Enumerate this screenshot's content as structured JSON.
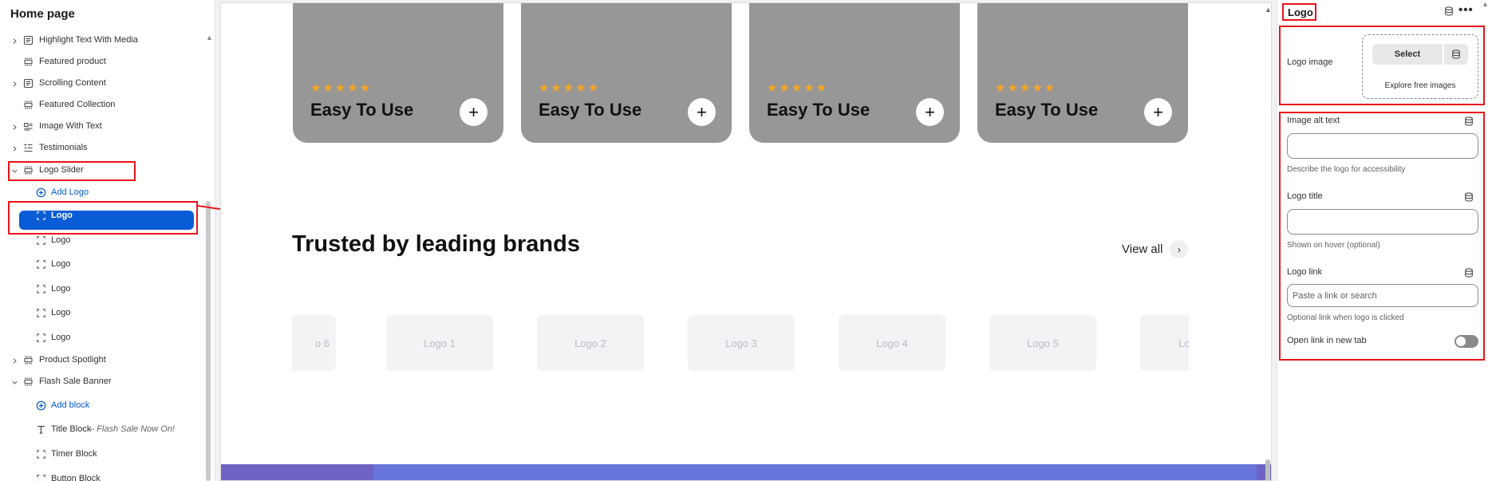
{
  "sidebar": {
    "title": "Home page",
    "items": [
      {
        "label": "Highlight Text With Media",
        "sub": "",
        "type": "section",
        "icon": "text-section-icon",
        "expand": ">",
        "selected": false
      },
      {
        "label": "Featured product",
        "sub": "",
        "type": "section",
        "icon": "layout-section-icon",
        "expand": "",
        "selected": false
      },
      {
        "label": "Scrolling Content",
        "sub": "",
        "type": "section",
        "icon": "text-section-icon",
        "expand": ">",
        "selected": false
      },
      {
        "label": "Featured Collection",
        "sub": "",
        "type": "section",
        "icon": "layout-section-icon",
        "expand": "",
        "selected": false
      },
      {
        "label": "Image With Text",
        "sub": "",
        "type": "section",
        "icon": "image-text-section-icon",
        "expand": ">",
        "selected": false
      },
      {
        "label": "Testimonials",
        "sub": "",
        "type": "section",
        "icon": "list-section-icon",
        "expand": ">",
        "selected": false
      },
      {
        "label": "Logo Slider",
        "sub": "",
        "type": "section",
        "icon": "layout-section-icon",
        "expand": "v",
        "selected": false
      },
      {
        "label": "Add Logo",
        "sub": "",
        "type": "add",
        "icon": "plus-circle-icon",
        "expand": "",
        "selected": false
      },
      {
        "label": "Logo",
        "sub": "",
        "type": "block",
        "icon": "block-icon",
        "expand": "",
        "selected": true
      },
      {
        "label": "Logo",
        "sub": "",
        "type": "block",
        "icon": "block-icon",
        "expand": "",
        "selected": false
      },
      {
        "label": "Logo",
        "sub": "",
        "type": "block",
        "icon": "block-icon",
        "expand": "",
        "selected": false
      },
      {
        "label": "Logo",
        "sub": "",
        "type": "block",
        "icon": "block-icon",
        "expand": "",
        "selected": false
      },
      {
        "label": "Logo",
        "sub": "",
        "type": "block",
        "icon": "block-icon",
        "expand": "",
        "selected": false
      },
      {
        "label": "Logo",
        "sub": "",
        "type": "block",
        "icon": "block-icon",
        "expand": "",
        "selected": false
      },
      {
        "label": "Product Spotlight",
        "sub": "",
        "type": "section",
        "icon": "layout-section-icon",
        "expand": ">",
        "selected": false
      },
      {
        "label": "Flash Sale Banner",
        "sub": "",
        "type": "section",
        "icon": "layout-section-icon",
        "expand": "v",
        "selected": false
      },
      {
        "label": "Add block",
        "sub": "",
        "type": "add",
        "icon": "plus-circle-icon",
        "expand": "",
        "selected": false
      },
      {
        "label": "Title Block",
        "sub": "– Flash Sale Now On!",
        "type": "block",
        "icon": "text-t-icon",
        "expand": "",
        "selected": false
      },
      {
        "label": "Timer Block",
        "sub": "",
        "type": "block",
        "icon": "block-icon",
        "expand": "",
        "selected": false
      },
      {
        "label": "Button Block",
        "sub": "",
        "type": "block",
        "icon": "block-icon",
        "expand": "",
        "selected": false
      }
    ]
  },
  "canvas": {
    "cards": [
      {
        "stars": "★★★★★",
        "title": "Easy To Use",
        "button": "+"
      },
      {
        "stars": "★★★★★",
        "title": "Easy To Use",
        "button": "+"
      },
      {
        "stars": "★★★★★",
        "title": "Easy To Use",
        "button": "+"
      },
      {
        "stars": "★★★★★",
        "title": "Easy To Use",
        "button": "+"
      }
    ],
    "heading": "Trusted by leading brands",
    "view_all": "View all",
    "view_all_icon": "›",
    "logos": [
      "o 6",
      "Logo 1",
      "Logo 2",
      "Logo 3",
      "Logo 4",
      "Logo 5",
      "Lo"
    ]
  },
  "panel": {
    "title": "Logo",
    "more": "•••",
    "logo_image_label": "Logo image",
    "select_label": "Select",
    "explore_label": "Explore free images",
    "alt_text_label": "Image alt text",
    "alt_text_help": "Describe the logo for accessibility",
    "alt_text_value": "",
    "logo_title_label": "Logo title",
    "logo_title_help": "Shown on hover (optional)",
    "logo_title_value": "",
    "logo_link_label": "Logo link",
    "logo_link_placeholder": "Paste a link or search",
    "logo_link_help": "Optional link when logo is clicked",
    "new_tab_label": "Open link in new tab",
    "new_tab_on": false
  },
  "colors": {
    "selection": "#0a5bd6",
    "link": "#005bd3",
    "annotation": "#e8141c",
    "card": "#979797",
    "stars": "#f5a623",
    "banner": "#6774dc"
  }
}
